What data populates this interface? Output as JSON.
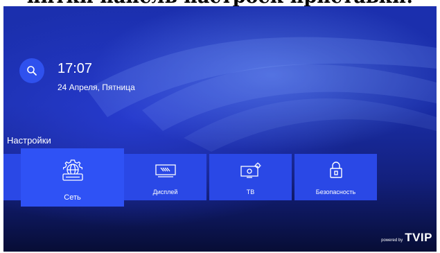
{
  "caption": "питки панель настроек приставки:",
  "clock": {
    "time": "17:07",
    "date": "24 Апреля, Пятница"
  },
  "section_label": "Настройки",
  "tiles": [
    {
      "label": "Сеть",
      "icon": "network-gear-icon",
      "selected": true
    },
    {
      "label": "Дисплей",
      "icon": "display-icon",
      "selected": false
    },
    {
      "label": "ТВ",
      "icon": "tv-settings-icon",
      "selected": false
    },
    {
      "label": "Безопасность",
      "icon": "lock-icon",
      "selected": false
    }
  ],
  "brand": {
    "powered_by": "powered by",
    "name": "TVIP"
  },
  "colors": {
    "tile": "#2a48e6",
    "tile_selected": "#2f52f5",
    "search_circle": "#2f51ee",
    "background": "#1a2ea8"
  }
}
